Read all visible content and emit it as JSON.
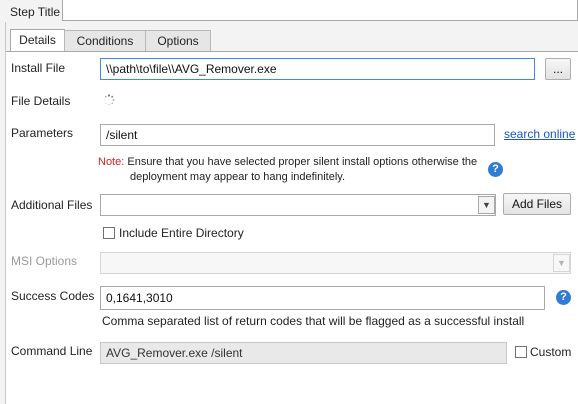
{
  "step_title": {
    "label": "Step Title",
    "value": ""
  },
  "tabs": [
    {
      "label": "Details"
    },
    {
      "label": "Conditions"
    },
    {
      "label": "Options"
    }
  ],
  "install_file": {
    "label": "Install File",
    "value": "\\\\path\\to\\file\\\\AVG_Remover.exe",
    "browse_label": "..."
  },
  "file_details": {
    "label": "File Details"
  },
  "parameters": {
    "label": "Parameters",
    "value": "/silent",
    "search_link": "search online",
    "note_prefix": "Note:",
    "note_line1": "Ensure that you have selected proper silent install options otherwise the",
    "note_line2": "deployment may appear to hang indefinitely."
  },
  "additional_files": {
    "label": "Additional Files",
    "value": "",
    "add_label": "Add Files",
    "include_dir_label": "Include Entire Directory",
    "include_dir_checked": false
  },
  "msi_options": {
    "label": "MSI Options",
    "value": "",
    "disabled": true
  },
  "success_codes": {
    "label": "Success Codes",
    "value": "0,1641,3010",
    "hint": "Comma separated list of return codes that will be flagged as a successful install"
  },
  "command_line": {
    "label": "Command Line",
    "value": "AVG_Remover.exe /silent",
    "custom_label": "Custom",
    "custom_checked": false
  },
  "icons": {
    "help": "question-circle-icon",
    "spinner": "loading-spinner-icon",
    "dropdown": "chevron-down-icon"
  },
  "colors": {
    "accent": "#2f7dd3",
    "note": "#d42020",
    "link": "#1a56c6"
  }
}
